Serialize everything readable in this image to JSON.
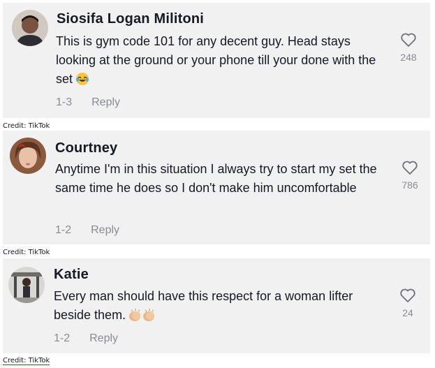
{
  "comments": [
    {
      "username": "Siosifa Logan Militoni",
      "text": "This is gym code 101 for any decent guy. Head stays looking at the ground or your phone till your done with the set",
      "emoji": "laughing-tears-emoji",
      "date": "1-3",
      "reply_label": "Reply",
      "like_count": "248",
      "like_icon": "heart-outline-icon"
    },
    {
      "username": "Courtney",
      "text": "Anytime I'm in this situation I always try to start my set the same time he does so I don't make him uncomfortable",
      "date": "1-2",
      "reply_label": "Reply",
      "like_count": "786",
      "like_icon": "heart-outline-icon"
    },
    {
      "username": "Katie",
      "text": "Every man should have this respect for a woman lifter beside them.",
      "emoji": "clapping-hands-emoji",
      "date": "1-2",
      "reply_label": "Reply",
      "like_count": "24",
      "like_icon": "heart-outline-icon"
    }
  ],
  "credits": [
    "Credit: TikTok",
    "Credit: TikTok",
    "Credit: TikTok"
  ],
  "colors": {
    "card_bg": "#f1f1f2",
    "text": "#161823",
    "muted": "#8a8b91"
  }
}
